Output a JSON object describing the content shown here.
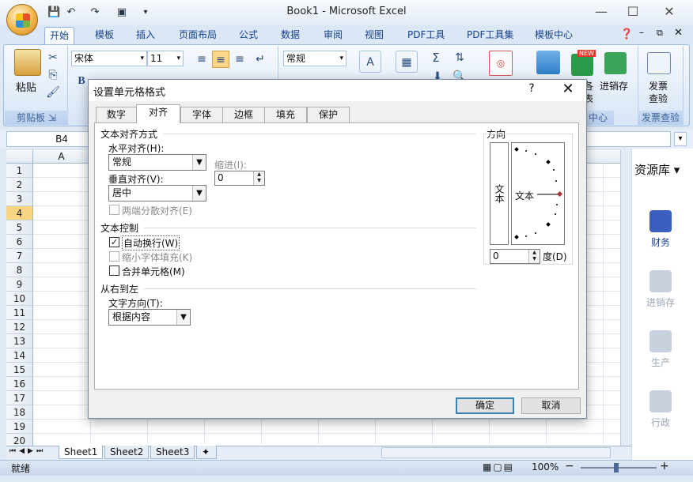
{
  "window": {
    "title": "Book1 - Microsoft Excel",
    "min": "—",
    "max": "☐",
    "close": "✕"
  },
  "ribbon_tabs": [
    "开始",
    "模板",
    "插入",
    "页面布局",
    "公式",
    "数据",
    "审阅",
    "视图",
    "PDF工具",
    "PDF工具集",
    "模板中心"
  ],
  "ribbon": {
    "paste_label": "粘贴",
    "font_name": "宋体",
    "font_size": "11",
    "number_format": "常规",
    "bold": "B",
    "sigma": "Σ",
    "new_badge": "NEW",
    "inventory_label": "进销存",
    "invoice_label_1": "发票",
    "invoice_label_2": "查验",
    "partial_label_1": "各",
    "partial_label_2": "表",
    "group_clipboard": "剪贴板",
    "group_center_partial": "中心",
    "group_invoice": "发票查验"
  },
  "formula_bar": {
    "name_box": "B4",
    "dropdown": "▾"
  },
  "sheet": {
    "col_a": "A",
    "rows": [
      "1",
      "2",
      "3",
      "4",
      "5",
      "6",
      "7",
      "8",
      "9",
      "10",
      "11",
      "12",
      "13",
      "14",
      "15",
      "16",
      "17",
      "18",
      "19",
      "20"
    ],
    "tabs": [
      "Sheet1",
      "Sheet2",
      "Sheet3"
    ]
  },
  "status": {
    "ready": "就绪",
    "zoom": "100%",
    "minus": "−",
    "plus": "+"
  },
  "side_panel": {
    "title": "资源库",
    "items": [
      "财务",
      "进销存",
      "生产",
      "行政"
    ]
  },
  "dialog": {
    "title": "设置单元格格式",
    "help": "?",
    "close": "✕",
    "tabs": [
      "数字",
      "对齐",
      "字体",
      "边框",
      "填充",
      "保护"
    ],
    "active_tab": "对齐",
    "text_align_section": "文本对齐方式",
    "horizontal_label": "水平对齐(H):",
    "horizontal_value": "常规",
    "indent_label": "缩进(I):",
    "indent_value": "0",
    "vertical_label": "垂直对齐(V):",
    "vertical_value": "居中",
    "distributed_label": "两端分散对齐(E)",
    "text_control_section": "文本控制",
    "wrap_label": "自动换行(W)",
    "shrink_label": "缩小字体填充(K)",
    "merge_label": "合并单元格(M)",
    "rtl_section": "从右到左",
    "text_dir_label": "文字方向(T):",
    "text_dir_value": "根据内容",
    "orientation_section": "方向",
    "orientation_vertical_text": "文本",
    "orientation_horizontal_text": "文本",
    "degrees_value": "0",
    "degrees_label": "度(D)",
    "ok": "确定",
    "cancel": "取消"
  }
}
